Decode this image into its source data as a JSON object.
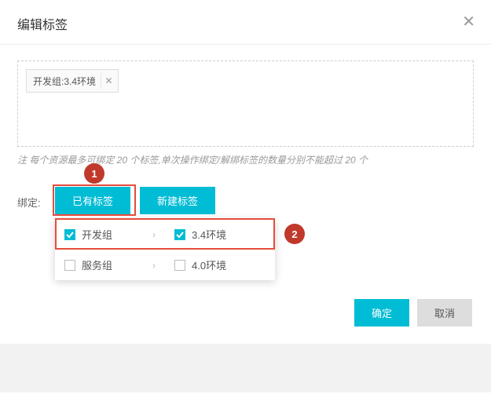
{
  "dialog": {
    "title": "编辑标签",
    "tag_text": "开发组:3.4环境",
    "note": "注 每个资源最多可绑定 20 个标签,单次操作绑定/解绑标签的数量分别不能超过 20 个",
    "bind_label": "绑定:",
    "tabs": {
      "existing": "已有标签",
      "new": "新建标签"
    },
    "options": {
      "left": [
        {
          "label": "开发组",
          "checked": true,
          "has_children": true
        },
        {
          "label": "服务组",
          "checked": false,
          "has_children": true
        }
      ],
      "right": [
        {
          "label": "3.4环境",
          "checked": true,
          "has_children": false
        },
        {
          "label": "4.0环境",
          "checked": false,
          "has_children": false
        }
      ]
    },
    "annotations": {
      "badge1": "1",
      "badge2": "2"
    },
    "buttons": {
      "ok": "确定",
      "cancel": "取消"
    }
  }
}
